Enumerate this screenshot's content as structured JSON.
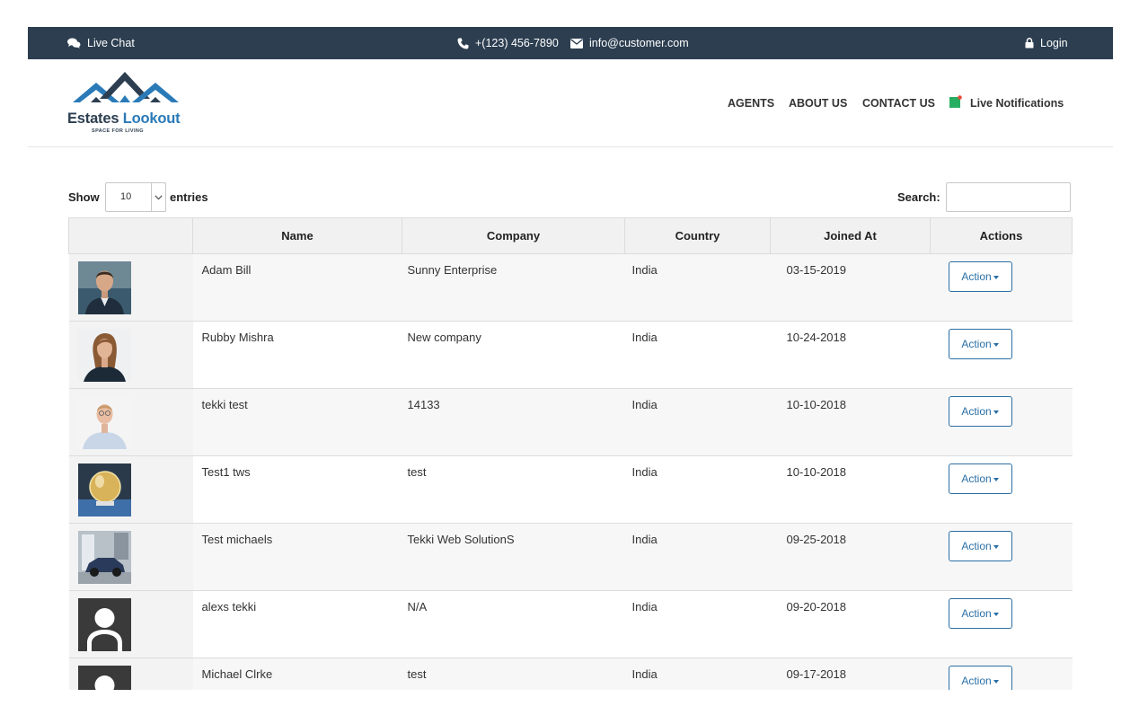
{
  "topbar": {
    "live_chat": "Live Chat",
    "phone": "+(123) 456-7890",
    "email": "info@customer.com",
    "login": "Login",
    "icons": [
      "chat-icon",
      "phone-icon",
      "envelope-icon",
      "lock-icon"
    ]
  },
  "header": {
    "logo_text_1": "Estates",
    "logo_text_2": "Lookout",
    "logo_tagline": "SPACE FOR LIVING",
    "nav": [
      "AGENTS",
      "ABOUT US",
      "CONTACT US"
    ],
    "notifications_label": "Live Notifications"
  },
  "controls": {
    "show_label": "Show",
    "entries_value": "10",
    "entries_label": "entries",
    "search_label": "Search:",
    "search_value": ""
  },
  "table": {
    "columns": [
      "",
      "Name",
      "Company",
      "Country",
      "Joined At",
      "Actions"
    ],
    "rows": [
      {
        "name": "Adam Bill",
        "company": "Sunny Enterprise",
        "country": "India",
        "joined": "03-15-2019",
        "action": "Action",
        "photo": "man-suit-photo"
      },
      {
        "name": "Rubby Mishra",
        "company": "New company",
        "country": "India",
        "joined": "10-24-2018",
        "action": "Action",
        "photo": "woman-photo"
      },
      {
        "name": "tekki test",
        "company": "14133",
        "country": "India",
        "joined": "10-10-2018",
        "action": "Action",
        "photo": "man-shirt-photo"
      },
      {
        "name": "Test1 tws",
        "company": "test",
        "country": "India",
        "joined": "10-10-2018",
        "action": "Action",
        "photo": "crystal-ball-photo"
      },
      {
        "name": "Test michaels",
        "company": "Tekki Web SolutionS",
        "country": "India",
        "joined": "09-25-2018",
        "action": "Action",
        "photo": "car-photo"
      },
      {
        "name": "alexs tekki",
        "company": "N/A",
        "country": "India",
        "joined": "09-20-2018",
        "action": "Action",
        "photo": "default-avatar"
      },
      {
        "name": "Michael Clrke",
        "company": "test",
        "country": "India",
        "joined": "09-17-2018",
        "action": "Action",
        "photo": "default-avatar"
      }
    ]
  },
  "colors": {
    "topbar_bg": "#2c3e50",
    "accent": "#2a6fa5",
    "notification_dot": "#27ae60"
  }
}
